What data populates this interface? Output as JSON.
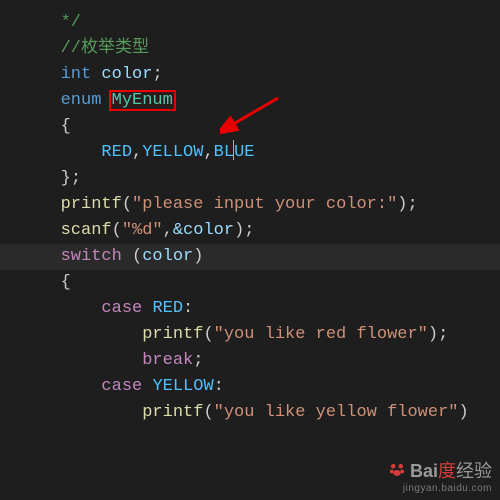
{
  "lines": {
    "comment_end": "*/",
    "comment_title": "//枚举类型",
    "decl_int": {
      "type": "int",
      "name": "color"
    },
    "decl_enum": {
      "kw": "enum",
      "name": "MyEnum"
    },
    "enum_body": "RED,YELLOW,BLUE",
    "printf1": {
      "fn": "printf",
      "arg": "\"please input your color:\""
    },
    "scanf": {
      "fn": "scanf",
      "fmt": "\"%d\"",
      "arg": "&color"
    },
    "switch": {
      "kw": "switch",
      "expr": "color"
    },
    "case_red": {
      "kw": "case",
      "val": "RED"
    },
    "case_red_body": {
      "fn": "printf",
      "arg": "\"you like red flower\""
    },
    "break": "break",
    "case_yellow": {
      "kw": "case",
      "val": "YELLOW"
    },
    "case_yellow_body": {
      "fn": "printf",
      "arg": "\"you like yellow flower\""
    }
  },
  "watermark": {
    "brand_left": "Bai",
    "brand_right": "经验",
    "sub": "jingyan.baidu.com"
  }
}
